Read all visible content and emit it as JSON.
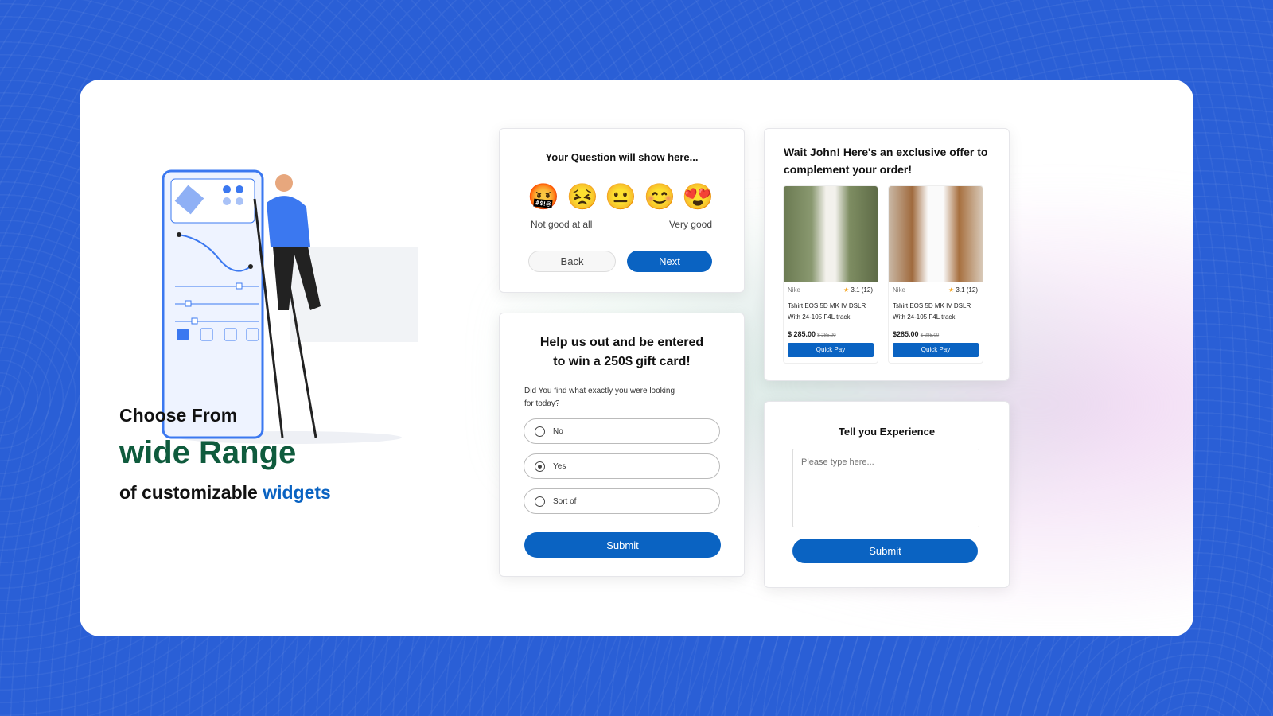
{
  "headline": {
    "line1": "Choose From",
    "line2": "wide Range",
    "line3_prefix": "of customizable ",
    "line3_accent": "widgets"
  },
  "colors": {
    "background": "#2a5fd6",
    "accent_green": "#0f5b3d",
    "accent_blue": "#0a63c2"
  },
  "rating_widget": {
    "question": "Your Question will show here...",
    "emojis": [
      "🤬",
      "😣",
      "😐",
      "😊",
      "😍"
    ],
    "low_label": "Not good at all",
    "high_label": "Very good",
    "back": "Back",
    "next": "Next"
  },
  "survey_widget": {
    "title_line1": "Help us out and be entered",
    "title_line2": "to win a 250$ gift card!",
    "question": "Did You find what exactly you were looking for today?",
    "options": [
      {
        "label": "No",
        "selected": false
      },
      {
        "label": "Yes",
        "selected": true
      },
      {
        "label": "Sort of",
        "selected": false
      }
    ],
    "submit": "Submit"
  },
  "offer_widget": {
    "title": "Wait John! Here's an exclusive offer to complement your order!",
    "products": [
      {
        "brand": "Nike",
        "rating": "3.1",
        "reviews": "(12)",
        "name": "Tshirt EOS 5D MK IV DSLR With 24-105 F4L track",
        "price": "$ 285.00",
        "old_price": "$ 285.00",
        "button": "Quick Pay"
      },
      {
        "brand": "Nike",
        "rating": "3.1",
        "reviews": "(12)",
        "name": "Tshirt EOS 5D MK IV DSLR With 24-105 F4L track",
        "price": "$285.00",
        "old_price": "$ 285.00",
        "button": "Quick Pay"
      }
    ]
  },
  "feedback_widget": {
    "title": "Tell you Experience",
    "placeholder": "Please type here...",
    "submit": "Submit"
  }
}
